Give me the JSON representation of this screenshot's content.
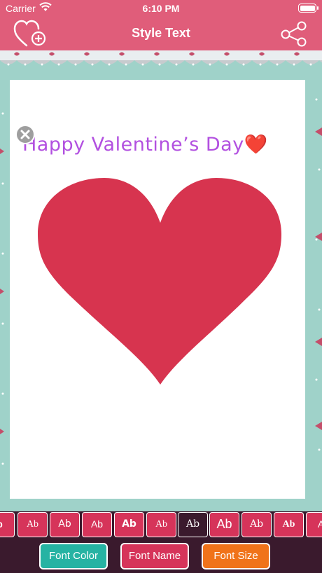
{
  "status_bar": {
    "carrier": "Carrier",
    "time": "6:10 PM"
  },
  "nav": {
    "title": "Style Text",
    "left_icon": "heart-add-icon",
    "right_icon": "share-icon"
  },
  "card": {
    "greeting": "Happy Valentine’s Day",
    "greeting_emoji": "❤️",
    "heart_color": "#d7344f",
    "greeting_color": "#b250e0"
  },
  "style_samples": [
    "b",
    "Ab",
    "Ab",
    "Ab",
    "Ab",
    "Ab",
    "Ab",
    "Ab",
    "Ab",
    "Ab",
    "A"
  ],
  "selected_style_index": 6,
  "tabs": {
    "font_color": {
      "label": "Font Color",
      "color": "#26b3a3"
    },
    "font_name": {
      "label": "Font Name",
      "color": "#d6345a"
    },
    "font_size": {
      "label": "Font Size",
      "color": "#f0731a"
    }
  },
  "colors": {
    "bar": "#e05d7a",
    "border_bg": "#9fd2c9",
    "toolbar_bg": "#3a1a2d"
  }
}
